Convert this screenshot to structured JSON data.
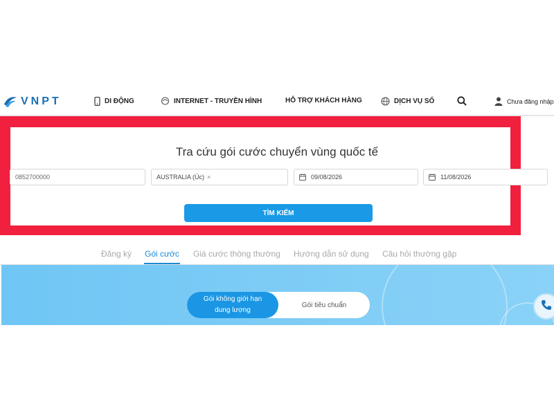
{
  "header": {
    "logo_text": "VNPT",
    "nav": [
      {
        "label": "DI ĐỘNG",
        "icon": "mobile-phone-icon"
      },
      {
        "label": "INTERNET - TRUYỀN HÌNH",
        "icon": "internet-tv-icon"
      },
      {
        "label": "HỖ TRỢ KHÁCH HÀNG",
        "icon": ""
      },
      {
        "label": "DỊCH VỤ SỐ",
        "icon": "globe-icon"
      }
    ],
    "search_icon": "search-icon",
    "user_label": "Chưa đăng nhập",
    "user_icon": "user-icon"
  },
  "search": {
    "title": "Tra cứu gói cước chuyển vùng quốc tế",
    "phone_value": "0852700000",
    "country_value": "AUSTRALIA (Úc)",
    "country_clear": "×",
    "date_from": "09/08/2026",
    "date_to": "11/08/2026",
    "button_label": "TÌM KIẾM"
  },
  "tabs": [
    {
      "label": "Đăng ký"
    },
    {
      "label": "Gói cước"
    },
    {
      "label": "Giá cước thông thường"
    },
    {
      "label": "Hướng dẫn sử dụng"
    },
    {
      "label": "Câu hỏi thường gặp"
    }
  ],
  "hero": {
    "toggle_on_line1": "Gói không giới hạn",
    "toggle_on_line2": "dung lượng",
    "toggle_off": "Gói tiêu chuẩn"
  },
  "colors": {
    "accent": "#1a96e4",
    "highlight_frame": "#f0203e",
    "hero_bg": "#7dccf6"
  }
}
